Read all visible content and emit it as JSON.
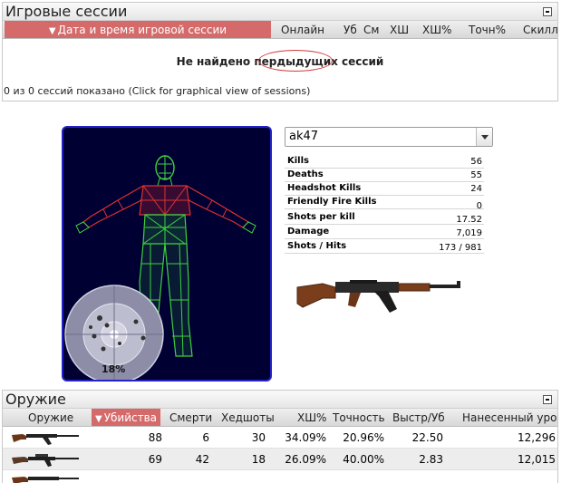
{
  "sessions": {
    "title": "Игровые сессии",
    "columns": [
      "Дата и время игровой сессии",
      "Онлайн",
      "Уб",
      "См",
      "ХШ",
      "ХШ%",
      "Точн%",
      "Скилл"
    ],
    "empty_message": "Не найдено пердыдущих сессий",
    "count_text": "0 из 0 сессий показано",
    "graph_link": "(Click for graphical view of sessions)"
  },
  "hitbox": {
    "accuracy_label": "18%"
  },
  "weapon_stats": {
    "selected_weapon": "ak47",
    "rows": [
      {
        "label": "Kills",
        "value": "56"
      },
      {
        "label": "Deaths",
        "value": "55"
      },
      {
        "label": "Headshot Kills",
        "value": "24"
      },
      {
        "label": "Friendly Fire Kills",
        "value": "0"
      },
      {
        "label": "Shots per kill",
        "value": "17.52"
      },
      {
        "label": "Damage",
        "value": "7,019"
      },
      {
        "label": "Shots / Hits",
        "value": "173 / 981"
      }
    ]
  },
  "weapons": {
    "title": "Оружие",
    "columns": [
      "Оружие",
      "Убийства",
      "Смерти",
      "Хедшоты",
      "ХШ%",
      "Точность",
      "Выстр/Уб",
      "Нанесенный урон"
    ],
    "rows": [
      {
        "kills": "88",
        "deaths": "6",
        "headshots": "30",
        "hs_pct": "34.09%",
        "accuracy": "20.96%",
        "shots_per_kill": "22.50",
        "damage": "12,296"
      },
      {
        "kills": "69",
        "deaths": "42",
        "headshots": "18",
        "hs_pct": "26.09%",
        "accuracy": "40.00%",
        "shots_per_kill": "2.83",
        "damage": "12,015"
      }
    ]
  },
  "colors": {
    "sorted_header": "#d56a6a",
    "model_background": "#000033",
    "model_border": "#2323c8",
    "mesh_green": "#3fd23f",
    "mesh_red": "#e03030"
  }
}
